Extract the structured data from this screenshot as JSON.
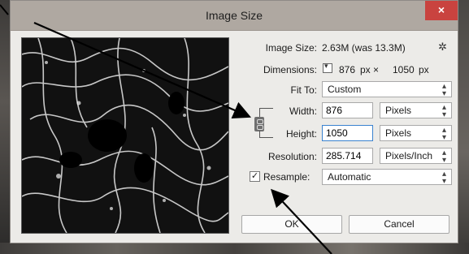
{
  "dialog": {
    "title": "Image Size",
    "close_label": "×"
  },
  "image_size": {
    "label": "Image Size:",
    "value": "2.63M (was 13.3M)"
  },
  "dimensions": {
    "label": "Dimensions:",
    "width": "876",
    "unit_x": "px  ×",
    "height": "1050",
    "unit": "px"
  },
  "fit_to": {
    "label": "Fit To:",
    "value": "Custom"
  },
  "width": {
    "label": "Width:",
    "value": "876",
    "unit": "Pixels"
  },
  "height": {
    "label": "Height:",
    "value": "1050",
    "unit": "Pixels"
  },
  "resolution": {
    "label": "Resolution:",
    "value": "285.714",
    "unit": "Pixels/Inch"
  },
  "resample": {
    "label": "Resample:",
    "checked": true,
    "check_glyph": "✓",
    "value": "Automatic"
  },
  "buttons": {
    "ok": "OK",
    "cancel": "Cancel"
  },
  "icons": {
    "gear": "gear-icon",
    "chain": "link-icon",
    "dropdown": "chevron-down-icon"
  },
  "colors": {
    "titlebar": "#afa8a1",
    "close": "#c9433f",
    "dialog_bg": "#ecebe8",
    "focus": "#3a82cf"
  }
}
